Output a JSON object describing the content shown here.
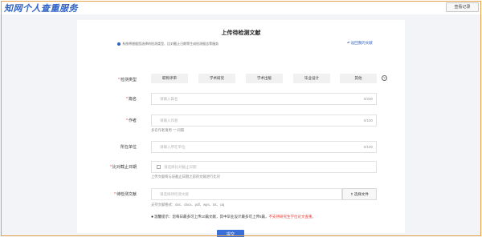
{
  "header": {
    "logo_text": "知网个人查重服务",
    "history_button": "查看记录"
  },
  "page": {
    "title": "上传待检测文献",
    "notice": "系统将根据您选择的检测类型、比对截止日期等生成检测报告等服务",
    "back_link": "返回我的文献"
  },
  "detection_type": {
    "label": "检测类型",
    "options": [
      "职称评审",
      "学术研究",
      "学术出版",
      "毕业设计",
      "其他"
    ],
    "help_icon": "?"
  },
  "title_field": {
    "label": "篇名",
    "placeholder": "请输入篇名",
    "count": "0/200"
  },
  "author_field": {
    "label": "作者",
    "placeholder": "请输入作者",
    "count": "0/100",
    "hint": "多名作者请用 \";\" 间隔"
  },
  "unit_field": {
    "label": "所在单位",
    "placeholder": "请输入所在单位",
    "count": "0/100"
  },
  "date_field": {
    "label": "比对截止日期",
    "placeholder": "请选择比对截止日期",
    "hint": "上传文献将与该截止日期之前的文献进行比对"
  },
  "file_field": {
    "label": "待检测文献",
    "placeholder": "请选择待检测文献",
    "select_button": "选择文件",
    "hint": "支持文献格式：doc、docx、pdf、wps、txt、caj"
  },
  "tip": {
    "prefix": "温馨提示：",
    "text": "您每日最多可上传10篇文献，其中毕业设计最多可上传5篇，",
    "warning": "不支持研究生学位论文查重。"
  },
  "submit_button": "提交"
}
